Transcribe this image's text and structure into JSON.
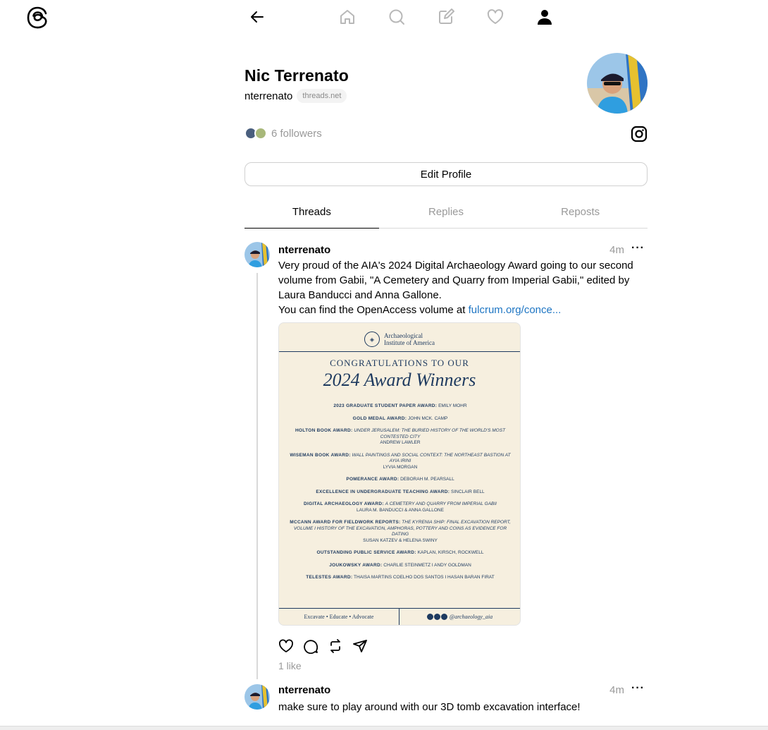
{
  "nav": {
    "logo": "threads-logo-icon",
    "items": [
      "back-arrow-icon",
      "home-icon",
      "search-icon",
      "compose-icon",
      "heart-icon",
      "profile-icon"
    ]
  },
  "profile": {
    "display_name": "Nic Terrenato",
    "handle": "nterrenato",
    "domain": "threads.net",
    "followers": "6 followers",
    "edit_button": "Edit Profile"
  },
  "tabs": [
    {
      "label": "Threads",
      "active": true
    },
    {
      "label": "Replies",
      "active": false
    },
    {
      "label": "Reposts",
      "active": false
    }
  ],
  "posts": [
    {
      "user": "nterrenato",
      "time": "4m",
      "more": "···",
      "text": "Very proud of the AIA's 2024 Digital Archaeology Award going to our second volume from Gabii, \"A Cemetery and Quarry from Imperial Gabii,\" edited by Laura Banducci and Anna Gallone.",
      "text2": "You can find the OpenAccess volume at ",
      "link": "fulcrum.org/conce...",
      "likes": "1 like",
      "image": {
        "org_line1": "Archaeological",
        "org_line2": "Institute of America",
        "congrats": "CONGRATULATIONS TO OUR",
        "title": "2024 Award Winners",
        "awards": [
          {
            "award": "2023 GRADUATE STUDENT PAPER AWARD:",
            "work": "",
            "winner": "EMILY MOHR"
          },
          {
            "award": "GOLD MEDAL AWARD:",
            "work": "",
            "winner": "JOHN MCK. CAMP"
          },
          {
            "award": "HOLTON BOOK AWARD:",
            "work": "UNDER JERUSALEM: THE BURIED HISTORY OF THE WORLD'S MOST CONTESTED CITY",
            "winner": "ANDREW LAWLER"
          },
          {
            "award": "WISEMAN BOOK AWARD:",
            "work": "WALL PAINTINGS AND SOCIAL CONTEXT: THE NORTHEAST BASTION AT AYIA IRINI",
            "winner": "LYVIA MORGAN"
          },
          {
            "award": "POMERANCE AWARD:",
            "work": "",
            "winner": "DEBORAH M. PEARSALL"
          },
          {
            "award": "EXCELLENCE IN UNDERGRADUATE TEACHING AWARD:",
            "work": "",
            "winner": "SINCLAIR BELL"
          },
          {
            "award": "DIGITAL ARCHAEOLOGY AWARD:",
            "work": "A CEMETERY AND QUARRY FROM IMPERIAL GABII",
            "winner": "LAURA M. BANDUCCI & ANNA GALLONE"
          },
          {
            "award": "MCCANN AWARD FOR FIELDWORK REPORTS:",
            "work": "THE KYRENIA SHIP: FINAL EXCAVATION REPORT, VOLUME I HISTORY OF THE EXCAVATION, AMPHORAS, POTTERY AND COINS AS EVIDENCE FOR DATING",
            "winner": "SUSAN KATZEV & HELENA SWINY"
          },
          {
            "award": "OUTSTANDING PUBLIC SERVICE AWARD:",
            "work": "",
            "winner": "KAPLAN, KIRSCH, ROCKWELL"
          },
          {
            "award": "JOUKOWSKY AWARD:",
            "work": "",
            "winner": "CHARLIE STEINMETZ I ANDY GOLDMAN"
          },
          {
            "award": "TELESTES AWARD:",
            "work": "",
            "winner": "THAISA MARTINS COELHO DOS SANTOS I HASAN BARAN FIRAT"
          }
        ],
        "footer_left": "Excavate  •  Educate  •  Advocate",
        "footer_right": "@archaeology_aia"
      }
    },
    {
      "user": "nterrenato",
      "time": "4m",
      "more": "···",
      "text": "make sure to play around with our 3D tomb excavation interface!"
    }
  ],
  "colors": {
    "link": "#1d75c3",
    "muted": "#999999",
    "border": "#d9d9d9",
    "poster_bg": "#f6efdf",
    "poster_ink": "#1e3a5f"
  }
}
